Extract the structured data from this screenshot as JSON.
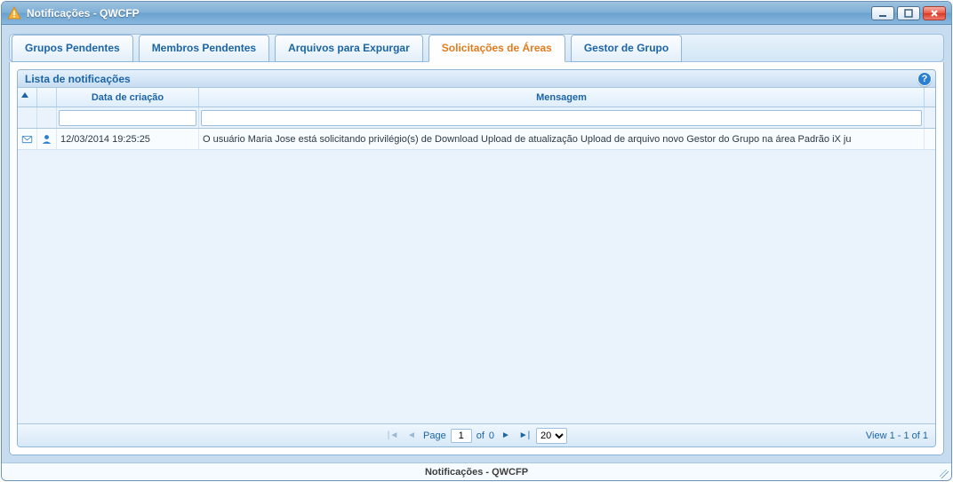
{
  "window": {
    "title": "Notificações - QWCFP"
  },
  "tabs": [
    {
      "label": "Grupos Pendentes"
    },
    {
      "label": "Membros Pendentes"
    },
    {
      "label": "Arquivos para Expurgar"
    },
    {
      "label": "Solicitações de Áreas"
    },
    {
      "label": "Gestor de Grupo"
    }
  ],
  "active_tab_index": 3,
  "grid": {
    "title": "Lista de notificações",
    "columns": {
      "date": "Data de criação",
      "message": "Mensagem"
    },
    "rows": [
      {
        "icon1": "mail-icon",
        "icon2": "role-icon",
        "date": "12/03/2014 19:25:25",
        "message": "O usuário Maria Jose está solicitando privilégio(s) de Download Upload de atualização Upload de arquivo novo Gestor do Grupo  na área Padrão iX ju"
      }
    ]
  },
  "pager": {
    "page_label": "Page",
    "page": "1",
    "of_label": "of",
    "total_pages": "0",
    "page_size": "20",
    "view_text": "View 1 - 1 of 1"
  },
  "statusbar": {
    "text": "Notificações - QWCFP"
  },
  "help_icon": "?"
}
